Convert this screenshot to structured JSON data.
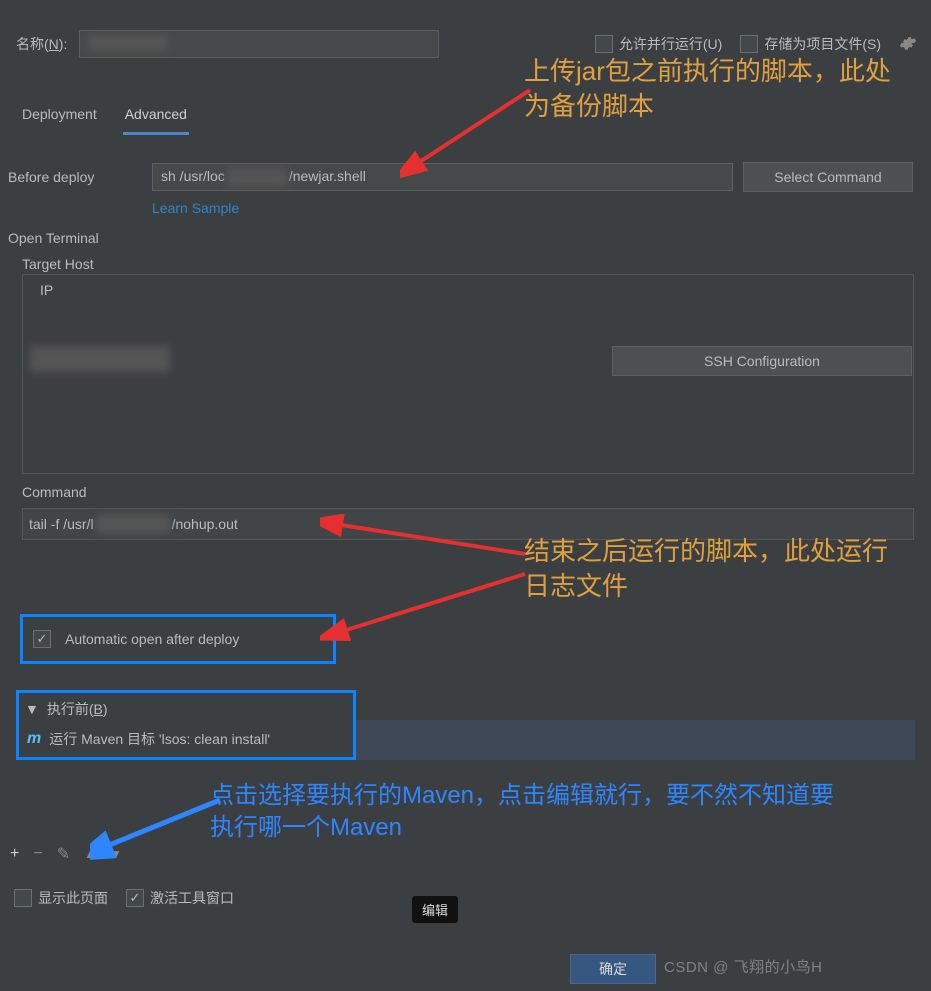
{
  "top": {
    "name_label_pre": "名称(",
    "name_label_u": "N",
    "name_label_post": "):",
    "allow_parallel": "允许并行运行(U)",
    "store_as_project": "存储为项目文件(S)"
  },
  "tabs": {
    "deployment": "Deployment",
    "advanced": "Advanced"
  },
  "before_deploy": {
    "label": "Before deploy",
    "value_pre": "sh /usr/loc",
    "value_post": "/newjar.shell",
    "select_command": "Select Command",
    "learn_sample": "Learn Sample"
  },
  "open_terminal": {
    "label": "Open Terminal",
    "target_host": "Target Host",
    "ip": "IP",
    "ssh_config": "SSH Configuration"
  },
  "command": {
    "label": "Command",
    "value_pre": "tail -f /usr/l",
    "value_post": "/nohup.out"
  },
  "auto_open": "Automatic open after deploy",
  "before_launch": {
    "header_pre": "执行前(",
    "header_u": "B",
    "header_post": ")",
    "maven_line": "运行 Maven 目标 'lsos: clean install'"
  },
  "toolbar": {
    "add": "+",
    "remove": "−",
    "edit": "✎",
    "up": "▲",
    "down": "▼"
  },
  "bottom": {
    "show_page": "显示此页面",
    "activate_tool": "激活工具窗口",
    "edit_tip": "编辑",
    "ok": "确定"
  },
  "watermark": "CSDN @ 飞翔的小鸟H",
  "anno": {
    "a1": "上传jar包之前执行的脚本，此处为备份脚本",
    "a2": "结束之后运行的脚本，此处运行日志文件",
    "a3": "点击选择要执行的Maven，点击编辑就行，要不然不知道要执行哪一个Maven"
  }
}
